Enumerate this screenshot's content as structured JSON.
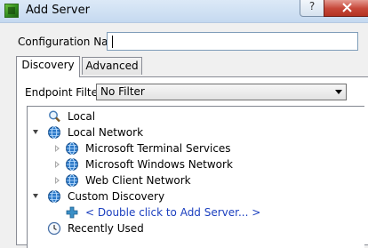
{
  "window": {
    "title": "Add Server",
    "help_glyph": "?",
    "close_glyph": "x"
  },
  "config": {
    "label": "Configuration Name",
    "value": ""
  },
  "tabs": [
    {
      "label": "Discovery",
      "active": true
    },
    {
      "label": "Advanced",
      "active": false
    }
  ],
  "endpoint_filter": {
    "label": "Endpoint Filter:",
    "selected": "No Filter"
  },
  "tree": [
    {
      "label": "Local",
      "icon": "magnifier-icon",
      "expander": "none",
      "depth": 0
    },
    {
      "label": "Local Network",
      "icon": "network-globe-icon",
      "expander": "expanded",
      "depth": 0
    },
    {
      "label": "Microsoft Terminal Services",
      "icon": "network-globe-icon",
      "expander": "collapsed",
      "depth": 1
    },
    {
      "label": "Microsoft Windows Network",
      "icon": "network-globe-icon",
      "expander": "collapsed",
      "depth": 1
    },
    {
      "label": "Web Client Network",
      "icon": "network-globe-icon",
      "expander": "collapsed",
      "depth": 1
    },
    {
      "label": "Custom Discovery",
      "icon": "network-globe-icon",
      "expander": "expanded",
      "depth": 0
    },
    {
      "label": "< Double click to Add Server... >",
      "icon": "plus-icon",
      "expander": "none",
      "depth": 1
    },
    {
      "label": "Recently Used",
      "icon": "clock-icon",
      "expander": "none",
      "depth": 0
    }
  ],
  "colors": {
    "link": "#1b3fbf",
    "globe": "#2a78c8",
    "plus": "#3a8fc6"
  }
}
